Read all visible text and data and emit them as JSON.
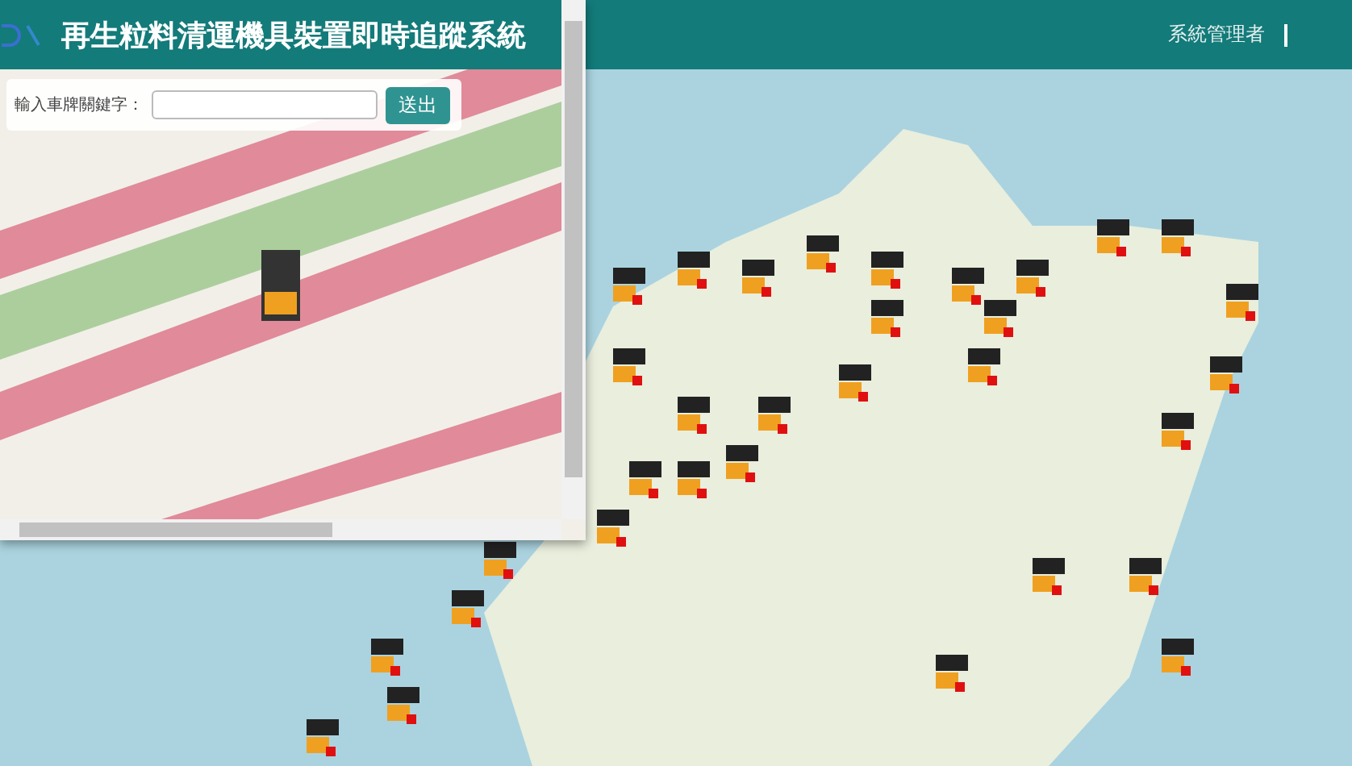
{
  "header": {
    "title": "再生粒料清運機具裝置即時追蹤系統",
    "user": "系統管理者"
  },
  "search": {
    "label": "輸入車牌關鍵字：",
    "button": "送出"
  }
}
